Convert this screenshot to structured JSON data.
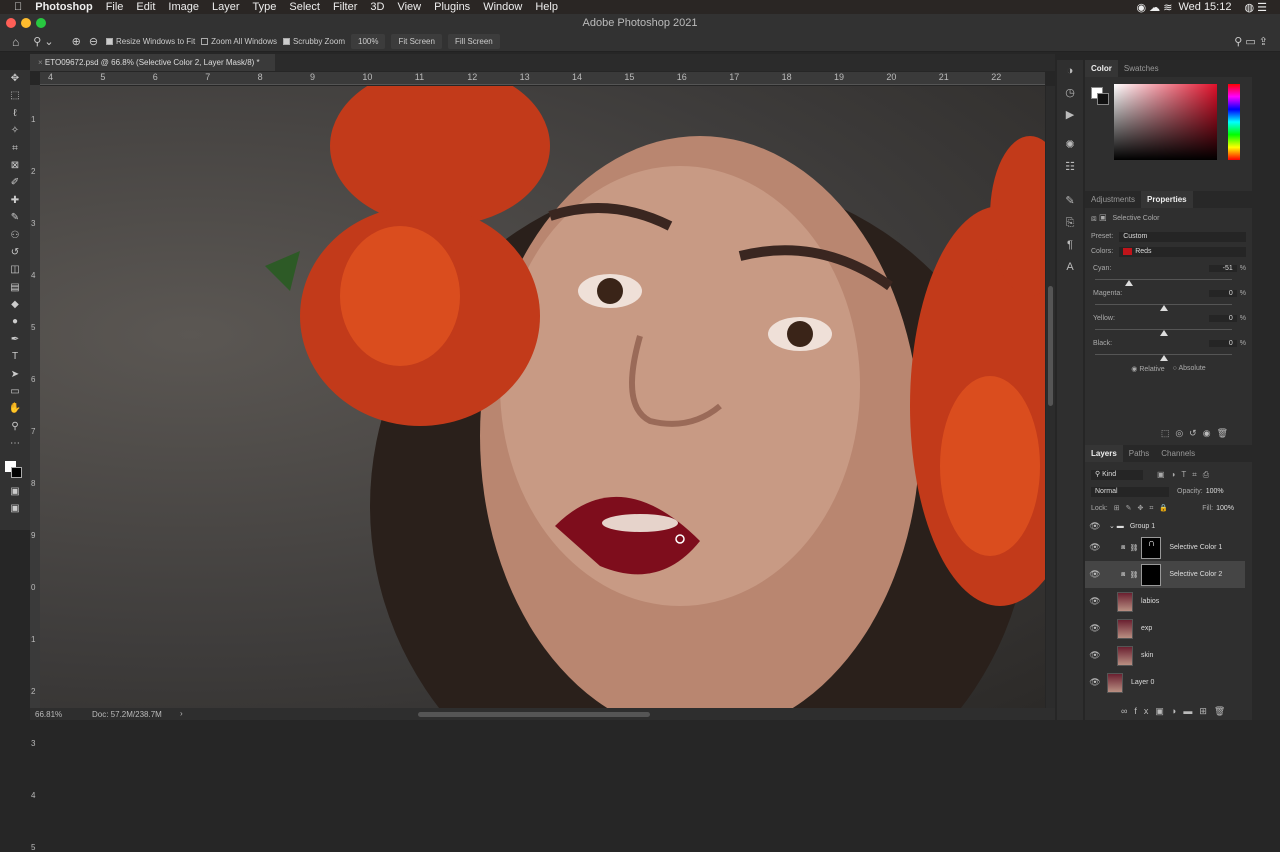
{
  "menubar": {
    "app": "Photoshop",
    "items": [
      "File",
      "Edit",
      "Image",
      "Layer",
      "Type",
      "Select",
      "Filter",
      "3D",
      "View",
      "Plugins",
      "Window",
      "Help"
    ],
    "clock": "Wed 15:12"
  },
  "window_title": "Adobe Photoshop 2021",
  "options": {
    "resize_windows": "Resize Windows to Fit",
    "zoom_all": "Zoom All Windows",
    "scrubby": "Scrubby Zoom",
    "zoom_100": "100%",
    "fit_screen": "Fit Screen",
    "fill_screen": "Fill Screen"
  },
  "document_tab": "ETO09672.psd @ 66.8% (Selective Color 2, Layer Mask/8) *",
  "ruler_top": [
    "4",
    "5",
    "6",
    "7",
    "8",
    "9",
    "10",
    "11",
    "12",
    "13",
    "14",
    "15",
    "16",
    "17",
    "18",
    "19",
    "20",
    "21",
    "22"
  ],
  "ruler_left": [
    "1",
    "2",
    "3",
    "4",
    "5",
    "6",
    "7",
    "8",
    "9",
    "0",
    "1",
    "2",
    "3",
    "4",
    "5"
  ],
  "status": {
    "zoom": "66.81%",
    "doc": "Doc: 57.2M/238.7M"
  },
  "color_panel": {
    "tabs": [
      "Color",
      "Swatches"
    ]
  },
  "properties": {
    "tabs": [
      "Adjustments",
      "Properties"
    ],
    "title": "Selective Color",
    "preset_label": "Preset:",
    "preset": "Custom",
    "colors_label": "Colors:",
    "colors": "Reds",
    "colors_swatch": "#c0141a",
    "sliders": [
      {
        "label": "Cyan:",
        "value": "-51",
        "pct": "%",
        "v": -51
      },
      {
        "label": "Magenta:",
        "value": "0",
        "pct": "%",
        "v": 0
      },
      {
        "label": "Yellow:",
        "value": "0",
        "pct": "%",
        "v": 0
      },
      {
        "label": "Black:",
        "value": "0",
        "pct": "%",
        "v": 0
      }
    ],
    "relative": "Relative",
    "absolute": "Absolute"
  },
  "layers": {
    "tabs": [
      "Layers",
      "Paths",
      "Channels"
    ],
    "kind": "Kind",
    "blend": "Normal",
    "opacity_label": "Opacity:",
    "opacity": "100%",
    "lock_label": "Lock:",
    "fill_label": "Fill:",
    "fill": "100%",
    "items": [
      "Group 1",
      "Selective Color 1",
      "Selective Color 2",
      "labios",
      "exp",
      "skin",
      "Layer 0"
    ]
  }
}
